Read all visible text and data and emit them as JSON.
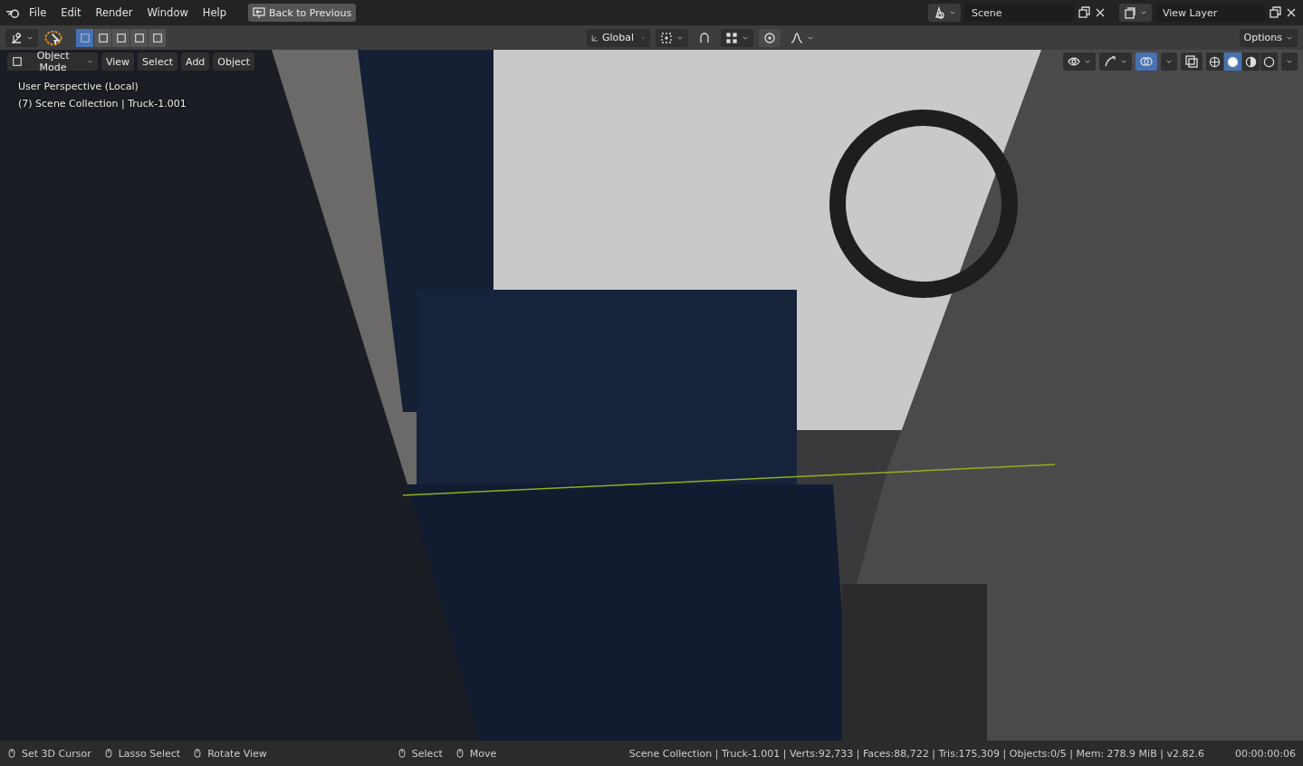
{
  "menu": [
    "File",
    "Edit",
    "Render",
    "Window",
    "Help"
  ],
  "back_button": "Back to Previous",
  "scene": {
    "value": "Scene"
  },
  "view_layer": {
    "value": "View Layer"
  },
  "select_modes": [
    {
      "selected": true
    },
    {
      "selected": false
    },
    {
      "selected": false
    },
    {
      "selected": false
    },
    {
      "selected": false
    }
  ],
  "transform_orientation": "Global",
  "snap": {
    "on": false
  },
  "proportional_editing": {
    "on": false
  },
  "options": "Options",
  "mode": "Object Mode",
  "viewport_menu": [
    "View",
    "Select",
    "Add",
    "Object"
  ],
  "overlay_info": [
    "User Perspective (Local)",
    "(7) Scene Collection | Truck-1.001"
  ],
  "overlays": {
    "on": true
  },
  "shading_modes": [
    {
      "selected": false
    },
    {
      "selected": true
    },
    {
      "selected": false
    },
    {
      "selected": false
    }
  ],
  "status_hints": [
    {
      "label": "Set 3D Cursor"
    },
    {
      "label": "Lasso Select"
    },
    {
      "label": "Rotate View"
    },
    {
      "label": "Select"
    },
    {
      "label": "Move"
    }
  ],
  "stats": "Scene Collection | Truck-1.001 | Verts:92,733 | Faces:88,722 | Tris:175,309 | Objects:0/5 | Mem: 278.9 MiB | v2.82.6",
  "time": "00:00:00:06"
}
